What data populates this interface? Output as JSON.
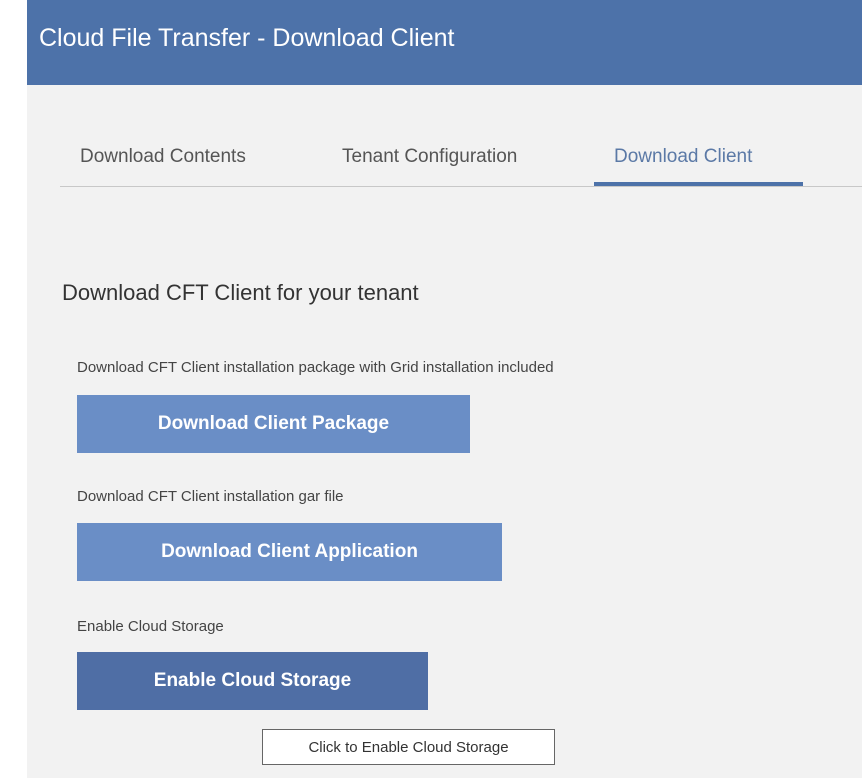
{
  "header": {
    "title": "Cloud File Transfer - Download Client"
  },
  "tabs": [
    {
      "label": "Download Contents",
      "active": false
    },
    {
      "label": "Tenant Configuration",
      "active": false
    },
    {
      "label": "Download Client",
      "active": true
    }
  ],
  "main": {
    "section_title": "Download CFT Client for your tenant",
    "package": {
      "description": "Download CFT Client installation package with Grid installation included",
      "button_label": "Download Client Package"
    },
    "application": {
      "description": "Download CFT Client installation gar file",
      "button_label": "Download Client Application"
    },
    "cloud_storage": {
      "description": "Enable Cloud Storage",
      "button_label": "Enable Cloud Storage"
    }
  },
  "tooltip": {
    "text": "Click to Enable Cloud Storage"
  },
  "colors": {
    "header_bg": "#4d72a9",
    "page_bg": "#f2f2f2",
    "button_light": "#6a8ec6",
    "button_dark": "#4f6ea5",
    "active_tab_text": "#5b79a6"
  }
}
